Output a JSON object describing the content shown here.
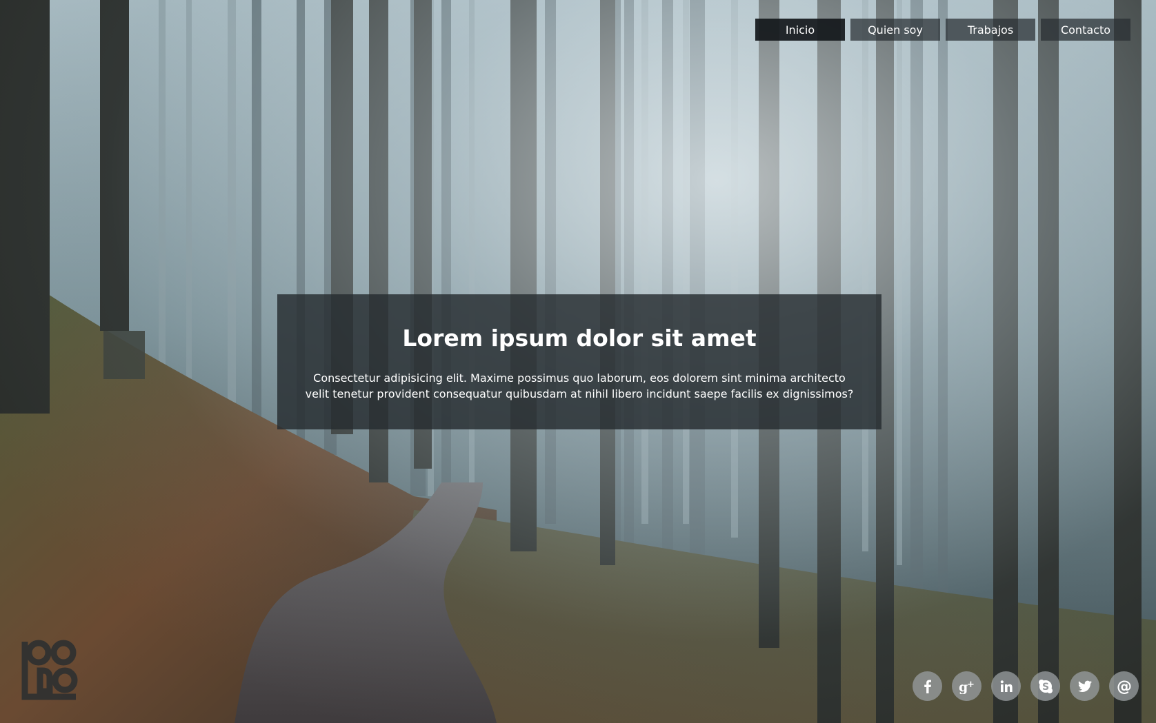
{
  "nav": {
    "items": [
      {
        "label": "Inicio",
        "active": true
      },
      {
        "label": "Quien soy",
        "active": false
      },
      {
        "label": "Trabajos",
        "active": false
      },
      {
        "label": "Contacto",
        "active": false
      }
    ]
  },
  "hero": {
    "title": "Lorem ipsum dolor sit amet",
    "text": "Consectetur adipisicing elit. Maxime possimus quo laborum, eos dolorem sint minima architecto velit tenetur provident consequatur quibusdam at nihil libero incidunt saepe facilis ex dignissimos?"
  },
  "social": {
    "icons": [
      "facebook-icon",
      "google-plus-icon",
      "linkedin-icon",
      "skype-icon",
      "twitter-icon",
      "email-icon"
    ]
  },
  "colors": {
    "nav_bg": "#2b3034",
    "nav_active_bg": "#15181b",
    "hero_bg": "#262c30",
    "social_bg": "#96999c",
    "text": "#ffffff"
  }
}
